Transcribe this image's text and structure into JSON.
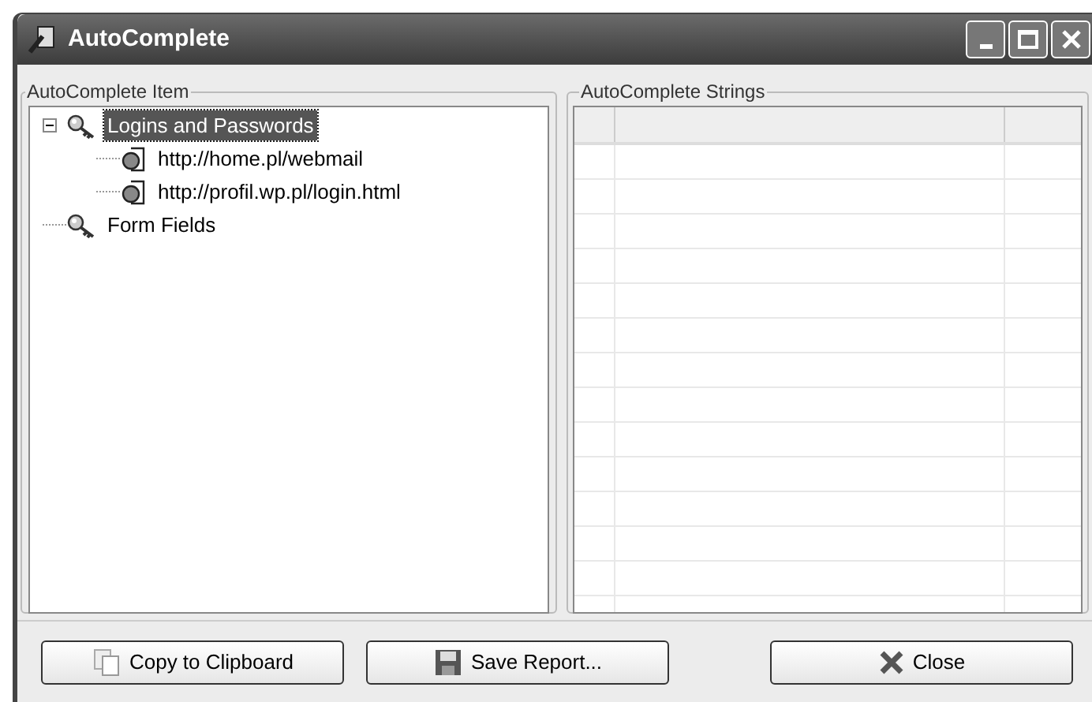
{
  "window": {
    "title": "AutoComplete"
  },
  "items_panel": {
    "label": "AutoComplete Item",
    "tree": [
      {
        "label": "Logins and Passwords",
        "kind": "key",
        "selected": true,
        "expanded": true,
        "children": [
          {
            "label": "http://home.pl/webmail",
            "kind": "page",
            "selected": false
          },
          {
            "label": "http://profil.wp.pl/login.html",
            "kind": "page",
            "selected": false
          }
        ]
      },
      {
        "label": "Form Fields",
        "kind": "key",
        "selected": false
      }
    ]
  },
  "strings_panel": {
    "label": "AutoComplete Strings"
  },
  "buttons": [
    {
      "label": "Copy to Clipboard",
      "kind": "copy"
    },
    {
      "label": "Save Report...",
      "kind": "save"
    },
    {
      "label": "Close",
      "kind": "close"
    }
  ]
}
